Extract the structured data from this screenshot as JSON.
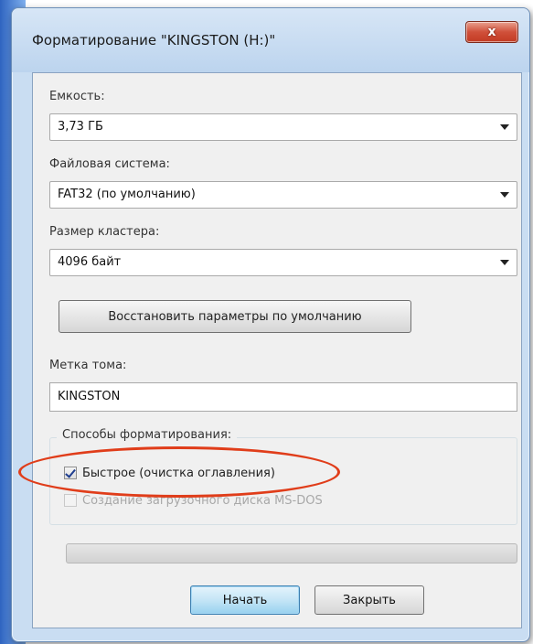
{
  "window": {
    "title": "Форматирование \"KINGSTON (H:)\"",
    "close_glyph": "x"
  },
  "capacity": {
    "label": "Емкость:",
    "value": "3,73 ГБ"
  },
  "filesystem": {
    "label": "Файловая система:",
    "value": "FAT32 (по умолчанию)"
  },
  "cluster": {
    "label": "Размер кластера:",
    "value": "4096 байт"
  },
  "restore_button": "Восстановить параметры по умолчанию",
  "volume": {
    "label": "Метка тома:",
    "value": "KINGSTON"
  },
  "format_options": {
    "title": "Способы форматирования:",
    "quick": {
      "label": "Быстрое (очистка оглавления)",
      "checked": true
    },
    "msdos": {
      "label": "Создание загрузочного диска MS-DOS",
      "checked": false,
      "disabled": true
    }
  },
  "progress": 0,
  "buttons": {
    "start": "Начать",
    "close": "Закрыть"
  },
  "colors": {
    "highlight": "#e03d1a",
    "titlebar": "#c9ddf2"
  }
}
